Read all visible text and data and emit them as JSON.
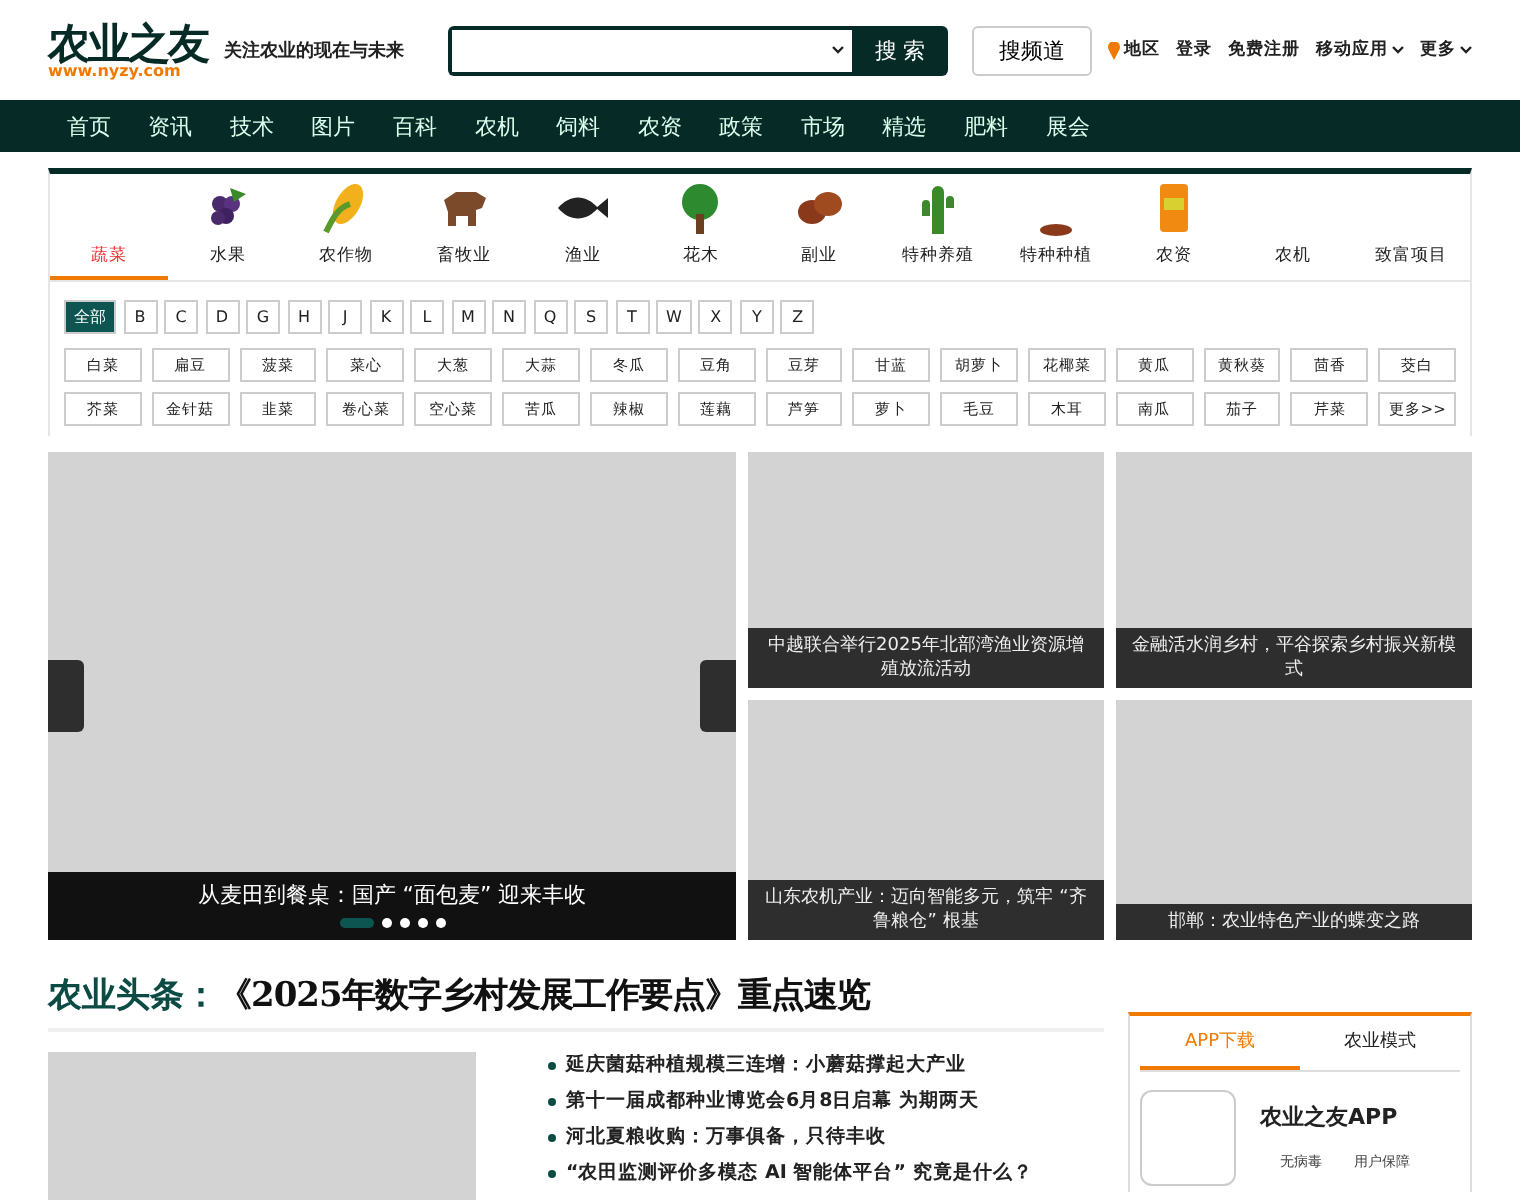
{
  "header": {
    "logo": "农业之友",
    "logo_url": "www.nyzy.com",
    "slogan": "关注农业的现在与未来",
    "search": {
      "button": "搜 索"
    },
    "channel_button": "搜频道",
    "links": [
      {
        "label": "地区",
        "kind": "location"
      },
      {
        "label": "登录",
        "kind": "plain"
      },
      {
        "label": "免费注册",
        "kind": "plain"
      },
      {
        "label": "移动应用",
        "kind": "dropdown"
      },
      {
        "label": "更多",
        "kind": "dropdown"
      }
    ]
  },
  "nav": [
    "首页",
    "资讯",
    "技术",
    "图片",
    "百科",
    "农机",
    "饲料",
    "农资",
    "政策",
    "市场",
    "精选",
    "肥料",
    "展会"
  ],
  "categories": [
    {
      "label": "蔬菜",
      "kind": "none",
      "selected": true
    },
    {
      "label": "水果",
      "kind": "grapes",
      "selected": false
    },
    {
      "label": "农作物",
      "kind": "corn",
      "selected": false
    },
    {
      "label": "畜牧业",
      "kind": "cow",
      "selected": false
    },
    {
      "label": "渔业",
      "kind": "fish",
      "selected": false
    },
    {
      "label": "花木",
      "kind": "tree",
      "selected": false
    },
    {
      "label": "副业",
      "kind": "potato",
      "selected": false
    },
    {
      "label": "特种养殖",
      "kind": "cactus",
      "selected": false
    },
    {
      "label": "特种种植",
      "kind": "mushroom",
      "selected": false
    },
    {
      "label": "农资",
      "kind": "bag",
      "selected": false
    },
    {
      "label": "农机",
      "kind": "none",
      "selected": false
    },
    {
      "label": "致富项目",
      "kind": "none",
      "selected": false
    }
  ],
  "letters": [
    {
      "label": "全部",
      "selected": true
    },
    {
      "label": "B",
      "selected": false
    },
    {
      "label": "C",
      "selected": false
    },
    {
      "label": "D",
      "selected": false
    },
    {
      "label": "G",
      "selected": false
    },
    {
      "label": "H",
      "selected": false
    },
    {
      "label": "J",
      "selected": false
    },
    {
      "label": "K",
      "selected": false
    },
    {
      "label": "L",
      "selected": false
    },
    {
      "label": "M",
      "selected": false
    },
    {
      "label": "N",
      "selected": false
    },
    {
      "label": "Q",
      "selected": false
    },
    {
      "label": "S",
      "selected": false
    },
    {
      "label": "T",
      "selected": false
    },
    {
      "label": "W",
      "selected": false
    },
    {
      "label": "X",
      "selected": false
    },
    {
      "label": "Y",
      "selected": false
    },
    {
      "label": "Z",
      "selected": false
    }
  ],
  "vegetables": [
    [
      "白菜",
      "扁豆",
      "菠菜",
      "菜心",
      "大葱",
      "大蒜",
      "冬瓜",
      "豆角",
      "豆芽",
      "甘蓝",
      "胡萝卜",
      "花椰菜",
      "黄瓜",
      "黄秋葵",
      "茴香",
      "茭白"
    ],
    [
      "芥菜",
      "金针菇",
      "韭菜",
      "卷心菜",
      "空心菜",
      "苦瓜",
      "辣椒",
      "莲藕",
      "芦笋",
      "萝卜",
      "毛豆",
      "木耳",
      "南瓜",
      "茄子",
      "芹菜",
      "更多>>"
    ]
  ],
  "slider": {
    "caption": "从麦田到餐桌：国产 “面包麦” 迎来丰收",
    "dots": [
      {
        "selected": true
      },
      {
        "selected": false
      },
      {
        "selected": false
      },
      {
        "selected": false
      },
      {
        "selected": false
      }
    ]
  },
  "cards": [
    "中越联合举行2025年北部湾渔业资源增殖放流活动",
    "金融活水润乡村，平谷探索乡村振兴新模式",
    "山东农机产业：迈向智能多元，筑牢 “齐鲁粮仓” 根基",
    "邯郸：农业特色产业的蝶变之路"
  ],
  "headline": {
    "label": "农业头条：",
    "title": "《2025年数字乡村发展工作要点》重点速览"
  },
  "news": [
    "延庆菌菇种植规模三连增：小蘑菇撑起大产业",
    "第十一届成都种业博览会6月8日启幕 为期两天",
    "河北夏粮收购：万事俱备，只待丰收",
    "“农田监测评价多模态 AI 智能体平台” 究竟是什么？"
  ],
  "app_panel": {
    "tabs": [
      {
        "label": "APP下载",
        "selected": true
      },
      {
        "label": "农业模式",
        "selected": false
      }
    ],
    "title": "农业之友APP",
    "features": [
      "无病毒",
      "用户保障"
    ]
  }
}
